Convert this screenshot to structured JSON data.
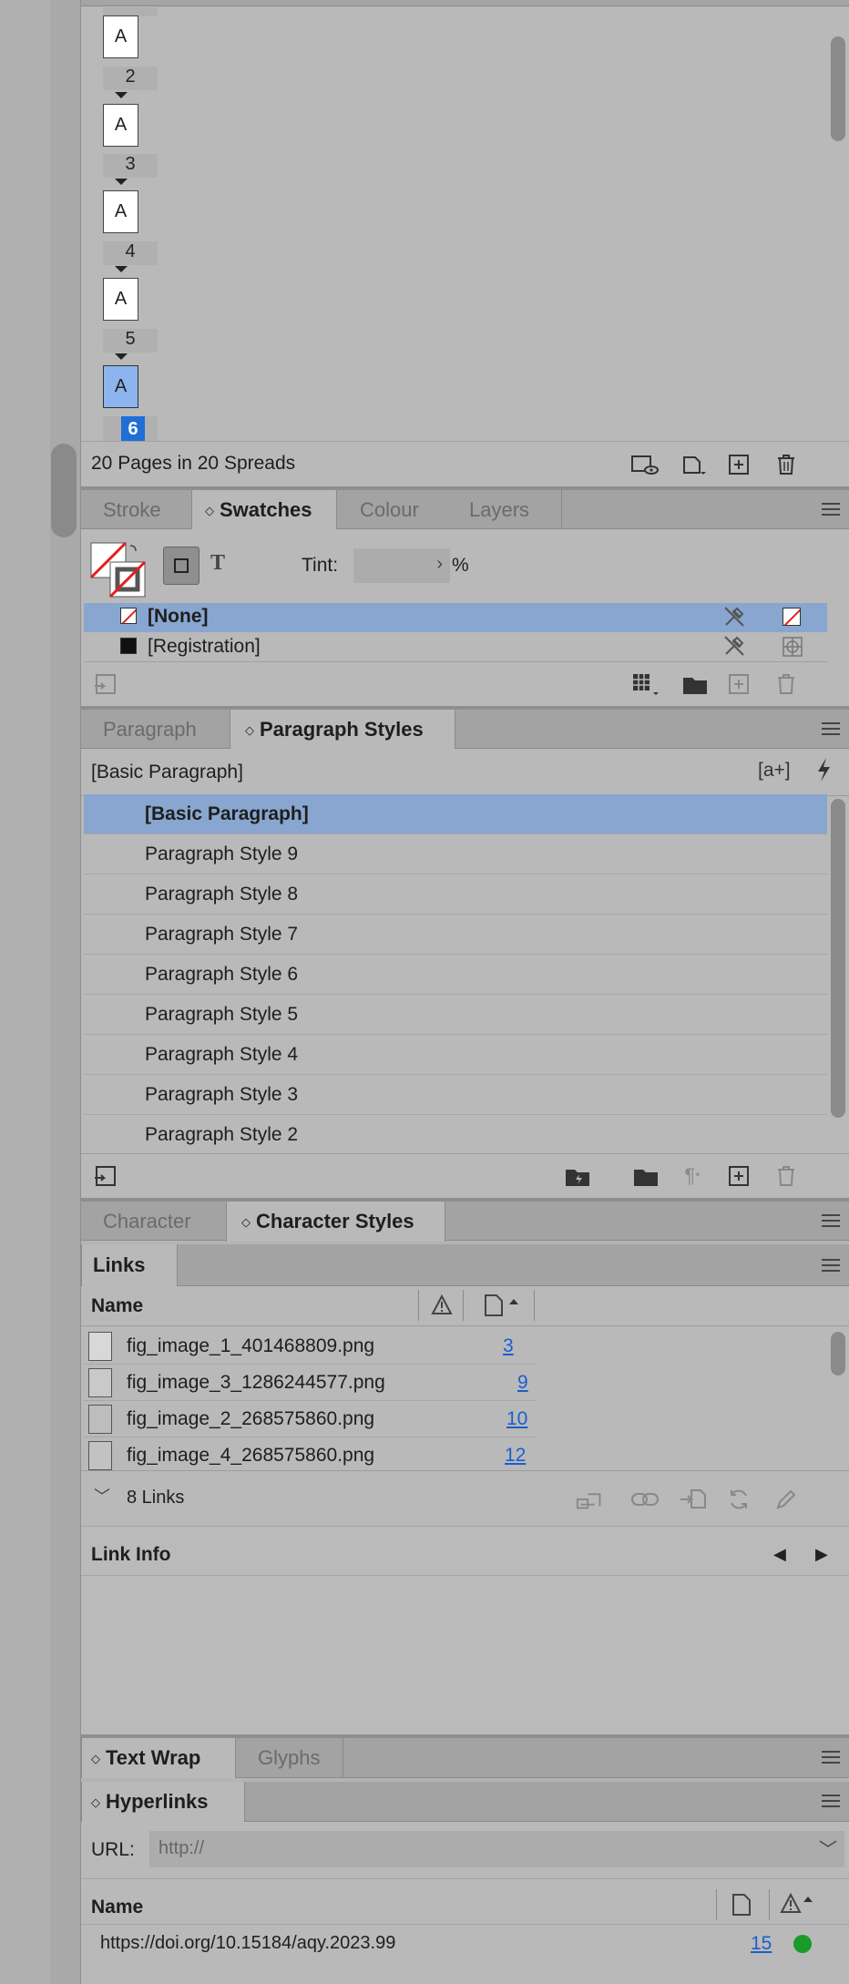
{
  "pages_panel": {
    "page_labels": [
      "2",
      "3",
      "4",
      "5",
      "6"
    ],
    "thumb_letter": "A",
    "status": "20 Pages in 20 Spreads"
  },
  "swatches_panel": {
    "tabs": [
      "Stroke",
      "Swatches",
      "Colour",
      "Layers"
    ],
    "active_tab": "Swatches",
    "tint_label": "Tint:",
    "tint_value": "",
    "percent": "%",
    "text_icon": "T",
    "swatches": [
      {
        "name": "[None]",
        "selected": true
      },
      {
        "name": "[Registration]",
        "selected": false
      }
    ]
  },
  "paragraph_panel": {
    "tabs": [
      "Paragraph",
      "Paragraph Styles"
    ],
    "active_tab": "Paragraph Styles",
    "current_style": "[Basic Paragraph]",
    "new_style_icon": "[a+]",
    "styles": [
      "[Basic Paragraph]",
      "Paragraph Style 9",
      "Paragraph Style 8",
      "Paragraph Style 7",
      "Paragraph Style 6",
      "Paragraph Style 5",
      "Paragraph Style 4",
      "Paragraph Style 3",
      "Paragraph Style 2"
    ]
  },
  "character_panel": {
    "tabs": [
      "Character",
      "Character Styles"
    ],
    "active_tab": "Character Styles"
  },
  "links_panel": {
    "tab": "Links",
    "col_name": "Name",
    "links": [
      {
        "name": "fig_image_1_401468809.png",
        "page": "3"
      },
      {
        "name": "fig_image_3_1286244577.png",
        "page": "9"
      },
      {
        "name": "fig_image_2_268575860.png",
        "page": "10"
      },
      {
        "name": "fig_image_4_268575860.png",
        "page": "12"
      }
    ],
    "count": "8 Links",
    "link_info": "Link Info"
  },
  "textwrap_panel": {
    "tabs": [
      "Text Wrap",
      "Glyphs"
    ],
    "active_tab": "Text Wrap"
  },
  "hyperlinks_panel": {
    "tab": "Hyperlinks",
    "url_label": "URL:",
    "url_placeholder": "http://",
    "col_name": "Name",
    "items": [
      {
        "name": "https://doi.org/10.15184/aqy.2023.99",
        "page": "15",
        "status_color": "#1a9a2a"
      }
    ]
  }
}
